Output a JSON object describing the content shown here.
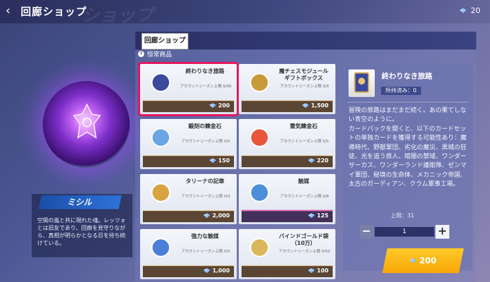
{
  "header": {
    "title": "回廊ショップ",
    "ghost_text": "ショップ",
    "currency": "20"
  },
  "character": {
    "name": "ミシル",
    "description": "空間の嵐と共に現れた魂。レッツォとは旧友であり、回廊を見守りながら、真相が明らかとなる日を待ち続けている。"
  },
  "shop": {
    "tab_label": "回廊ショップ",
    "sub_label": "恒常商品",
    "items": [
      {
        "name": "終わりなき旅路",
        "limit": "アカウントシーズン上限 9/40",
        "price": "200",
        "icon": "book-card-icon"
      },
      {
        "name": "魔チェスモジュール\nギフトボックス",
        "limit": "アカウントシーズン上限 0/3",
        "price": "1,500",
        "icon": "gift-box-icon"
      },
      {
        "name": "鍛刻の錬金石",
        "limit": "アカウントシーズン上限 0/5",
        "price": "150",
        "icon": "alchemy-stone-icon"
      },
      {
        "name": "霊気錬金石",
        "limit": "アカウントシーズン上限 0/5",
        "price": "220",
        "icon": "spirit-stone-icon"
      },
      {
        "name": "タリーナの記章",
        "limit": "アカウントシーズン上限 0/3",
        "price": "2,000",
        "icon": "badge-icon"
      },
      {
        "name": "触媒",
        "limit": "アカウントシーズン上限 0/8",
        "price": "125",
        "icon": "catalyst-icon"
      },
      {
        "name": "強力な触媒",
        "limit": "アカウントシーズン上限 0/5",
        "price": "1,000",
        "icon": "strong-catalyst-icon"
      },
      {
        "name": "バインドゴールド袋\n（10万）",
        "limit": "アカウントシーズン上限 0/50",
        "price": "100",
        "icon": "gold-bag-icon"
      }
    ]
  },
  "detail": {
    "name": "終わりなき旅路",
    "owned": "所持済み：0",
    "description": "冒険の旅路はまだまだ続く。あの果てしない青空のように。\nカードパックを開くと、以下のカードセットの単独カードを獲得する可能性あり：魔導時代、野獣軍団、劣化の魔災、黒城の狂徒、光を追う旅人、暗闇の禁域、ワンダーサーカス、ワンダーランド護衛隊、ゼンマイ軍団、秘境の生命体、メカニック帝国、太古のガーディアン、クラム軍事工場。",
    "limit": "上限：31",
    "quantity": "1",
    "buy_price": "200"
  },
  "colors": {
    "accent": "#f7a707",
    "selected": "#e3175f",
    "price_bar": "#5b4634"
  }
}
